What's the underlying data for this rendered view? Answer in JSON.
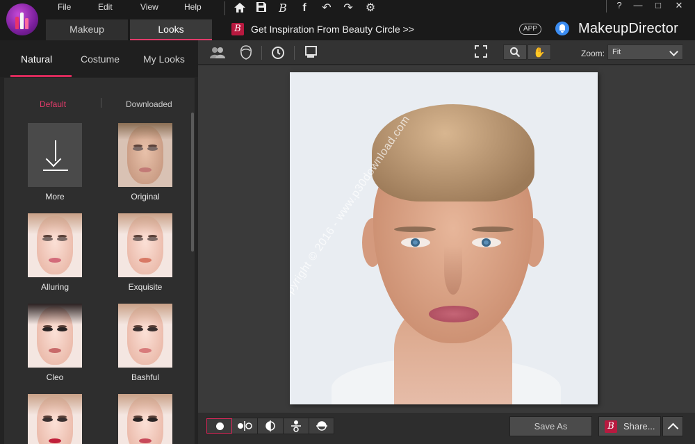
{
  "menu": {
    "file": "File",
    "edit": "Edit",
    "view": "View",
    "help": "Help"
  },
  "main_tabs": [
    {
      "label": "Makeup",
      "active": false
    },
    {
      "label": "Looks",
      "active": true
    }
  ],
  "inspiration": {
    "badge": "B",
    "text": "Get Inspiration From Beauty Circle >>"
  },
  "app_badge": "APP",
  "brand": "MakeupDirector",
  "window_buttons": {
    "help": "?",
    "minimize": "—",
    "maximize": "□",
    "close": "✕"
  },
  "looks_tabs": [
    {
      "label": "Natural",
      "active": true
    },
    {
      "label": "Costume",
      "active": false
    },
    {
      "label": "My Looks",
      "active": false
    }
  ],
  "filters": {
    "default": "Default",
    "downloaded": "Downloaded",
    "accent": "#d92a5b"
  },
  "looks": [
    {
      "label": "More",
      "kind": "more"
    },
    {
      "label": "Original",
      "kind": "male"
    },
    {
      "label": "Alluring",
      "kind": "female",
      "lip": "#d36b7a"
    },
    {
      "label": "Exquisite",
      "kind": "female",
      "lip": "#d87965"
    },
    {
      "label": "Cleo",
      "kind": "female",
      "lip": "#c86a6a"
    },
    {
      "label": "Bashful",
      "kind": "female",
      "lip": "#d87b7b"
    },
    {
      "label": "",
      "kind": "female",
      "lip": "#c0203a"
    },
    {
      "label": "",
      "kind": "female",
      "lip": "#c84a5a"
    }
  ],
  "canvas_toolbar": {
    "zoom_label": "Zoom:",
    "zoom_value": "Fit"
  },
  "watermark": "Copyright © 2016 - www.p30download.com",
  "bottom": {
    "save_as": "Save As",
    "share": "Share...",
    "share_badge": "B"
  },
  "colors": {
    "accent": "#d92a5b",
    "bell": "#3b8cf1",
    "badge": "#b8193f"
  }
}
